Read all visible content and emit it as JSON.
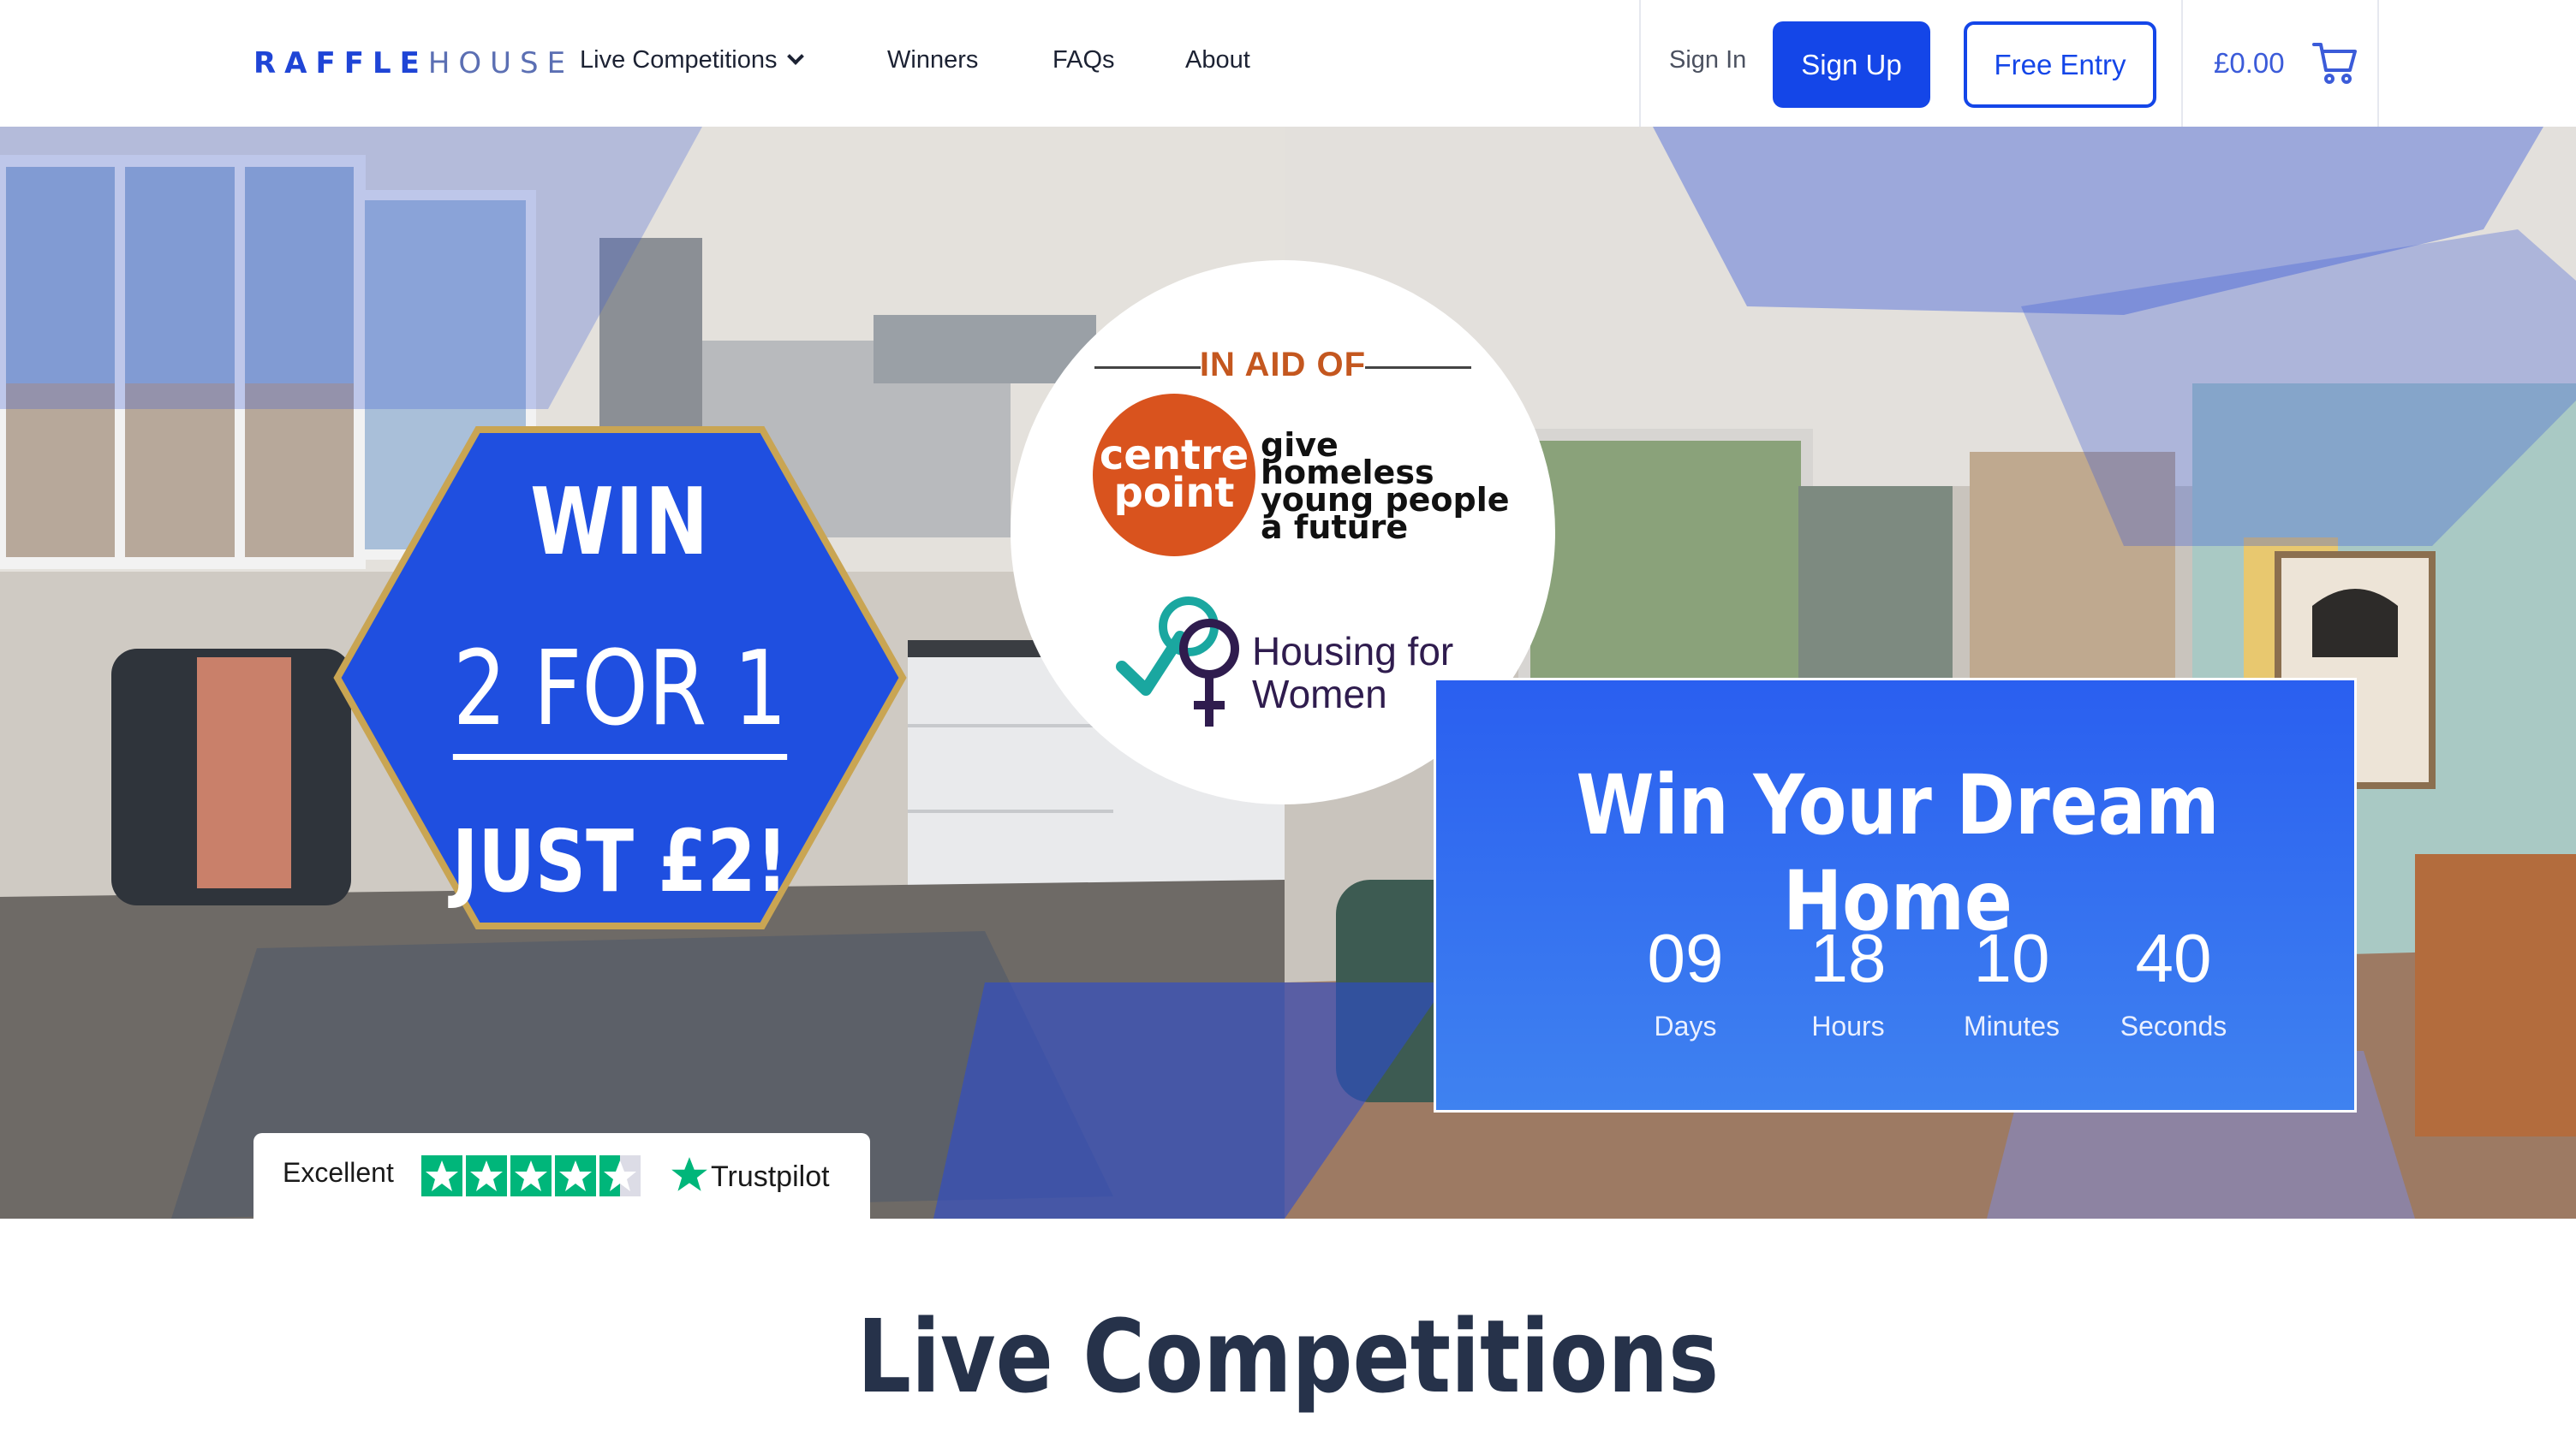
{
  "brand": {
    "logo_bold": "RAFFLE",
    "logo_light": "HOUSE"
  },
  "nav": {
    "live_competitions": "Live Competitions",
    "winners": "Winners",
    "faqs": "FAQs",
    "about": "About",
    "sign_in": "Sign In",
    "sign_up": "Sign Up",
    "free_entry": "Free Entry",
    "cart_total": "£0.00",
    "icons": [
      "chevron-down-icon",
      "cart-icon"
    ]
  },
  "hero": {
    "charity": {
      "heading": "IN AID OF",
      "centrepoint_name": "centre point",
      "centrepoint_tagline": "give homeless young people a future",
      "housing_for_women": "Housing for Women"
    },
    "offer": {
      "line1": "WIN",
      "line2": "2 FOR 1",
      "line3": "JUST £2!"
    },
    "countdown": {
      "title": "Win Your Dream Home",
      "days": "09",
      "hours": "18",
      "minutes": "10",
      "seconds": "40",
      "days_label": "Days",
      "hours_label": "Hours",
      "minutes_label": "Minutes",
      "seconds_label": "Seconds"
    },
    "trustpilot": {
      "rating_text": "Excellent",
      "brand": "Trustpilot",
      "stars": 4.5
    }
  },
  "main": {
    "section_title": "Live Competitions"
  },
  "colors": {
    "primary": "#1446e8",
    "countdown_top": "#2a5ff0",
    "centrepoint_orange": "#d9531e",
    "trustpilot_green": "#00b67a"
  }
}
